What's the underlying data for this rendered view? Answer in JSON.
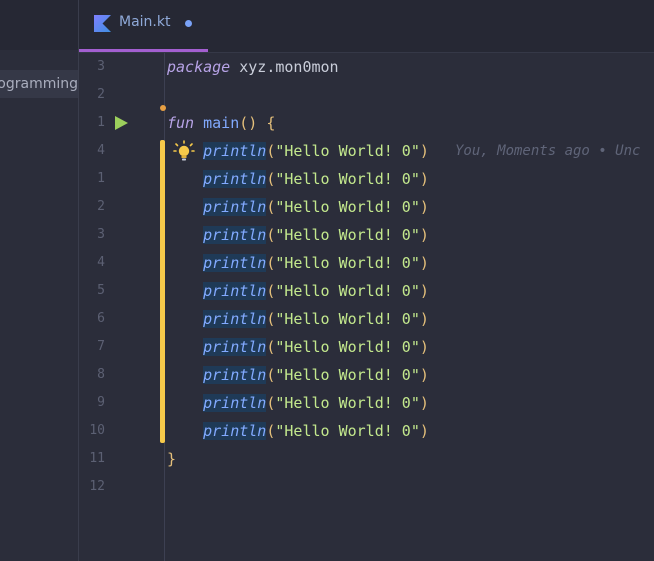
{
  "side_panel": {
    "item_label": "Programming"
  },
  "tab": {
    "filename": "Main.kt"
  },
  "editor": {
    "lines": [
      {
        "num": "3",
        "type": "package",
        "kw": "package",
        "rest": "xyz.mon0mon"
      },
      {
        "num": "2",
        "type": "blank"
      },
      {
        "num": "1",
        "type": "fun",
        "kw": "fun",
        "name": "main",
        "parens": "()",
        "brace": "{"
      },
      {
        "num": "4",
        "type": "println",
        "call": "println",
        "open": "(",
        "str": "\"Hello World! 0\"",
        "close": ")"
      },
      {
        "num": "1",
        "type": "println",
        "call": "println",
        "open": "(",
        "str": "\"Hello World! 0\"",
        "close": ")"
      },
      {
        "num": "2",
        "type": "println",
        "call": "println",
        "open": "(",
        "str": "\"Hello World! 0\"",
        "close": ")"
      },
      {
        "num": "3",
        "type": "println",
        "call": "println",
        "open": "(",
        "str": "\"Hello World! 0\"",
        "close": ")"
      },
      {
        "num": "4",
        "type": "println",
        "call": "println",
        "open": "(",
        "str": "\"Hello World! 0\"",
        "close": ")"
      },
      {
        "num": "5",
        "type": "println",
        "call": "println",
        "open": "(",
        "str": "\"Hello World! 0\"",
        "close": ")"
      },
      {
        "num": "6",
        "type": "println",
        "call": "println",
        "open": "(",
        "str": "\"Hello World! 0\"",
        "close": ")"
      },
      {
        "num": "7",
        "type": "println",
        "call": "println",
        "open": "(",
        "str": "\"Hello World! 0\"",
        "close": ")"
      },
      {
        "num": "8",
        "type": "println",
        "call": "println",
        "open": "(",
        "str": "\"Hello World! 0\"",
        "close": ")"
      },
      {
        "num": "9",
        "type": "println",
        "call": "println",
        "open": "(",
        "str": "\"Hello World! 0\"",
        "close": ")"
      },
      {
        "num": "10",
        "type": "println",
        "call": "println",
        "open": "(",
        "str": "\"Hello World! 0\"",
        "close": ")"
      },
      {
        "num": "11",
        "type": "close",
        "brace": "}"
      },
      {
        "num": "12",
        "type": "blank"
      }
    ],
    "blame_text": "You, Moments ago • Unc"
  },
  "icons": {
    "tab": "kotlin-file-icon",
    "run": "run-gutter-icon",
    "bulb": "lightbulb-icon"
  },
  "colors": {
    "tab_underline": "#a35fd0",
    "change_bar": "#f6c94a",
    "run_green": "#9ccf5c"
  }
}
